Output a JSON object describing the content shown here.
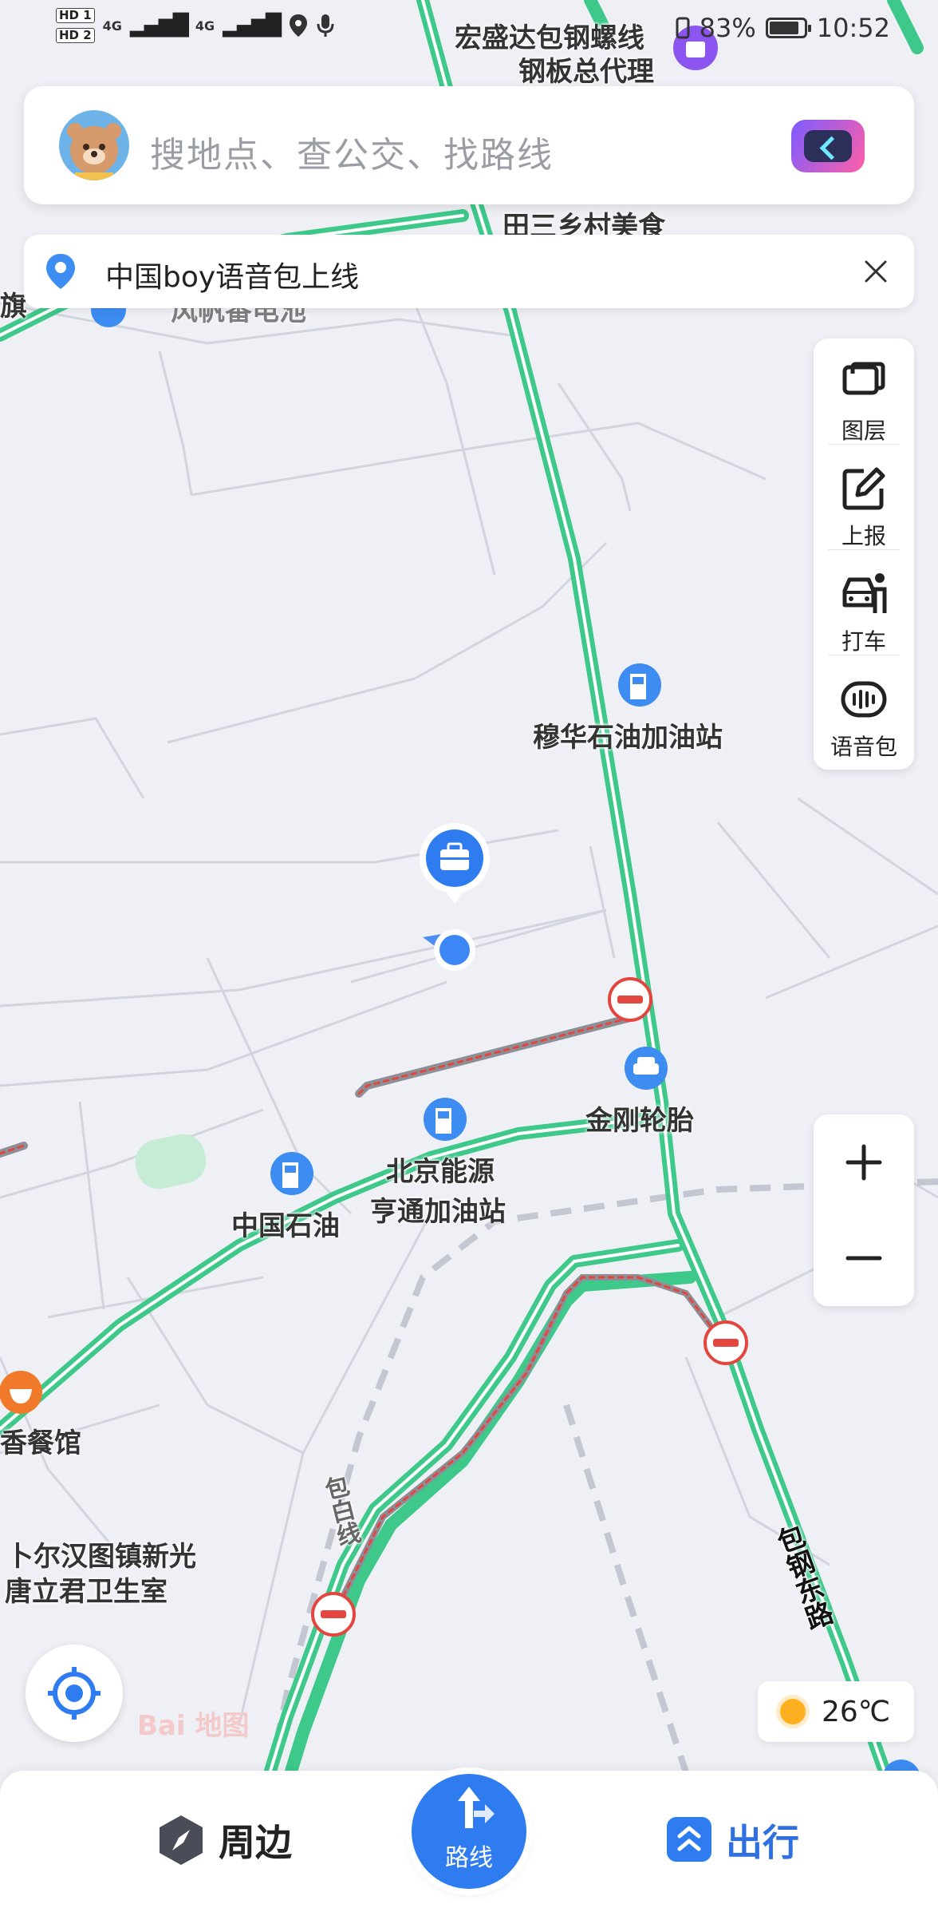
{
  "status_bar": {
    "hd1": "HD 1",
    "hd2": "HD 2",
    "network1": "4G",
    "network2": "4G",
    "battery_percent": "83%",
    "battery_level": 0.83,
    "time": "10:52"
  },
  "search": {
    "placeholder": "搜地点、查公交、找路线",
    "avatar_icon": "bear-avatar-icon",
    "assistant_icon": "voice-assistant-icon"
  },
  "notice": {
    "text": "中国boy语音包上线",
    "pin_icon": "location-pin-icon",
    "close_icon": "close-icon"
  },
  "tools": [
    {
      "label": "图层",
      "icon": "layers-icon"
    },
    {
      "label": "上报",
      "icon": "report-icon"
    },
    {
      "label": "打车",
      "icon": "taxi-icon"
    },
    {
      "label": "语音包",
      "icon": "voice-pack-icon"
    }
  ],
  "zoom": {
    "in": "+",
    "out": "−"
  },
  "weather": {
    "temperature": "26℃",
    "icon": "sun-icon"
  },
  "map_labels": {
    "hongshengda_1": "宏盛达包钢螺线",
    "hongshengda_2": "钢板总代理",
    "tiansan": "田三乡村美食",
    "fengfan": "风帆番电池",
    "qi_fragment": "旗",
    "muhua": "穆华石油加油站",
    "jingang": "金刚轮胎",
    "beijing_1": "北京能源",
    "beijing_2": "亨通加油站",
    "zhongguo": "中国石油",
    "xiangcanguan": "香餐馆",
    "buerhan_1": "卜尔汉图镇新光",
    "buerhan_2": "唐立君卫生室",
    "baobai": "包白线",
    "baogang": "包钢东路",
    "watermark": "Bai 地图"
  },
  "bottom": {
    "nearby": "周边",
    "route": "路线",
    "travel": "出行"
  },
  "colors": {
    "road_green": "#3ec98b",
    "accent_blue": "#2f7cf0",
    "map_bg": "#eef0f6",
    "restriction_red": "#e3463f",
    "poi_blue": "#3c8cf2"
  }
}
